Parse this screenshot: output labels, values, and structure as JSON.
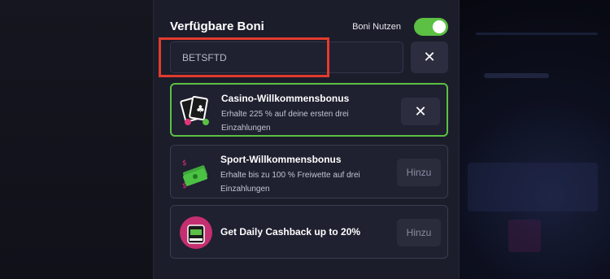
{
  "header": {
    "title": "Verfügbare Boni",
    "toggle_label": "Boni Nutzen",
    "toggle_on": true
  },
  "code": {
    "value": "BETSFTD",
    "clear_icon": "close-icon"
  },
  "bonuses": [
    {
      "name": "Casino-Willkommensbonus",
      "description": "Erhalte 225 % auf deine ersten drei Einzahlungen",
      "active": true,
      "button_icon": "close-icon",
      "image_icon": "playing-cards-icon"
    },
    {
      "name": "Sport-Willkommensbonus",
      "description": "Erhalte bis zu 100 % Freiwette auf drei Einzahlungen",
      "active": false,
      "button_label": "Hinzu",
      "image_icon": "money-stack-icon"
    },
    {
      "name": "Get Daily Cashback up to 20%",
      "description": "",
      "active": false,
      "button_label": "Hinzu",
      "image_icon": "slot-machine-icon"
    }
  ],
  "colors": {
    "accent_green": "#5bc044",
    "highlight_red": "#e23b2e",
    "panel_bg": "#1c1d2b"
  }
}
